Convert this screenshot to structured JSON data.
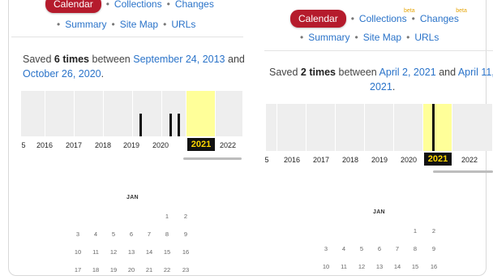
{
  "nav": {
    "calendar": "Calendar",
    "collections": "Collections",
    "changes": "Changes",
    "beta": "beta",
    "summary": "Summary",
    "sitemap": "Site Map",
    "urls": "URLs"
  },
  "left": {
    "saved_prefix": "Saved ",
    "saved_count": "6 times",
    "saved_mid": " between ",
    "date_from": "September 24, 2013",
    "saved_and": " and",
    "date_to": "October 26, 2020",
    "saved_end": ".",
    "years": [
      "5",
      "2016",
      "2017",
      "2018",
      "2019",
      "2020",
      "2021",
      "2022"
    ],
    "current_year": "2021",
    "month": "JAN",
    "days_row1": [
      "1",
      "2"
    ],
    "days_row2": [
      "3",
      "4",
      "5",
      "6",
      "7",
      "8",
      "9"
    ],
    "days_row3": [
      "10",
      "11",
      "12",
      "13",
      "14",
      "15",
      "16"
    ],
    "days_row4": [
      "17",
      "18",
      "19",
      "20",
      "21",
      "22",
      "23"
    ]
  },
  "right": {
    "saved_prefix": "Saved ",
    "saved_count": "2 times",
    "saved_mid": " between ",
    "date_from": "April 2, 2021",
    "saved_and": " and ",
    "date_to_line1": "April 11,",
    "date_to_line2": "2021",
    "saved_end": ".",
    "years": [
      "5",
      "2016",
      "2017",
      "2018",
      "2019",
      "2020",
      "2021",
      "2022"
    ],
    "current_year": "2021",
    "month": "JAN",
    "days_row1": [
      "1",
      "2"
    ],
    "days_row2": [
      "3",
      "4",
      "5",
      "6",
      "7",
      "8",
      "9"
    ],
    "days_row3": [
      "10",
      "11",
      "12",
      "13",
      "14",
      "15",
      "16"
    ]
  },
  "colors": {
    "brand_red": "#b51b2c",
    "link_blue": "#2a73c9",
    "highlight_yellow": "#ffff99",
    "current_year_bg": "#111111",
    "current_year_fg": "#ffd800"
  }
}
